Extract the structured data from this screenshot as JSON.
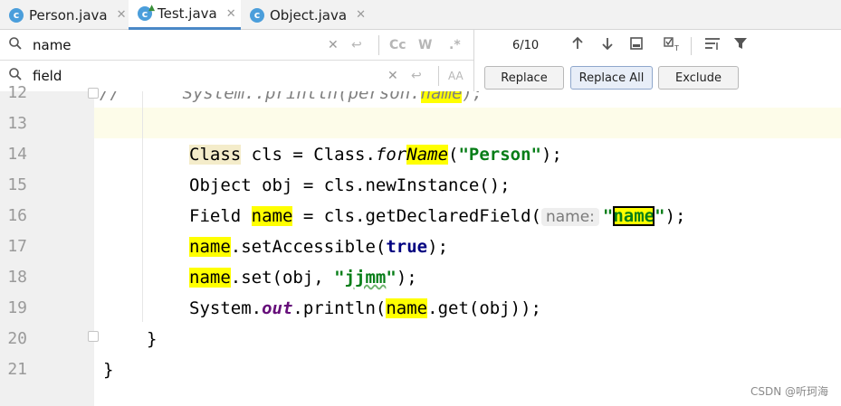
{
  "tabs": [
    {
      "name": "Person.java",
      "icon": "c-class-icon",
      "active": false
    },
    {
      "name": "Test.java",
      "icon": "c-class-runnable-icon",
      "active": true
    },
    {
      "name": "Object.java",
      "icon": "c-class-icon",
      "active": false
    }
  ],
  "find": {
    "search_value": "name",
    "replace_value": "field",
    "results": "6/10",
    "match_case_label": "Cc",
    "words_label": "W",
    "regex_label": ".*",
    "preserve_case_label": "A͏A",
    "replace_label": "Replace",
    "replace_all_label": "Replace All",
    "exclude_label": "Exclude"
  },
  "editor": {
    "line_numbers": [
      "12",
      "13",
      "14",
      "15",
      "16",
      "17",
      "18",
      "19",
      "20",
      "21"
    ],
    "line12": {
      "prefix": "//      System.",
      "out": "out",
      "mid": ".println(person.",
      "match": "name",
      "suffix": ");"
    },
    "line14": {
      "cls_type": "Class",
      "a": " cls = Class.",
      "for": "for",
      "Name": "Name",
      "b": "(",
      "str": "\"Person\"",
      "c": ");"
    },
    "line15": {
      "text": "Object obj = cls.newInstance();"
    },
    "line16": {
      "a": "Field ",
      "match": "name",
      "b": " = cls.getDeclaredField(",
      "hint": "name:",
      "q1": "\"",
      "match2": "name",
      "q2": "\"",
      "c": ");"
    },
    "line17": {
      "match": "name",
      "a": ".setAccessible(",
      "kw": "true",
      "b": ");"
    },
    "line18": {
      "match": "name",
      "a": ".set(obj, ",
      "q1": "\"",
      "str": "jjmm",
      "q2": "\"",
      "b": ");"
    },
    "line19": {
      "a": "System.",
      "out": "out",
      "b": ".println(",
      "match": "name",
      "c": ".get(obj));"
    },
    "line20": {
      "text": "}"
    },
    "line21": {
      "text": "}"
    }
  },
  "watermark": "CSDN @听珂海"
}
